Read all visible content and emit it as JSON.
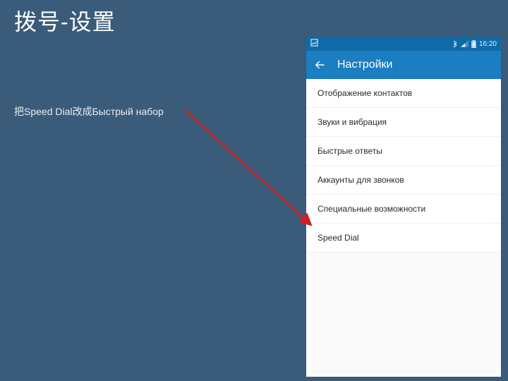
{
  "slide": {
    "title": "拨号-设置",
    "note": "把Speed Dial改成Быстрый набор"
  },
  "statusbar": {
    "time": "16:20"
  },
  "appbar": {
    "title": "Настройки"
  },
  "settings": [
    {
      "label": "Отображение контактов"
    },
    {
      "label": "Звуки и вибрация"
    },
    {
      "label": "Быстрые ответы"
    },
    {
      "label": "Аккаунты для звонков"
    },
    {
      "label": "Специальные возможности"
    },
    {
      "label": "Speed Dial"
    }
  ]
}
